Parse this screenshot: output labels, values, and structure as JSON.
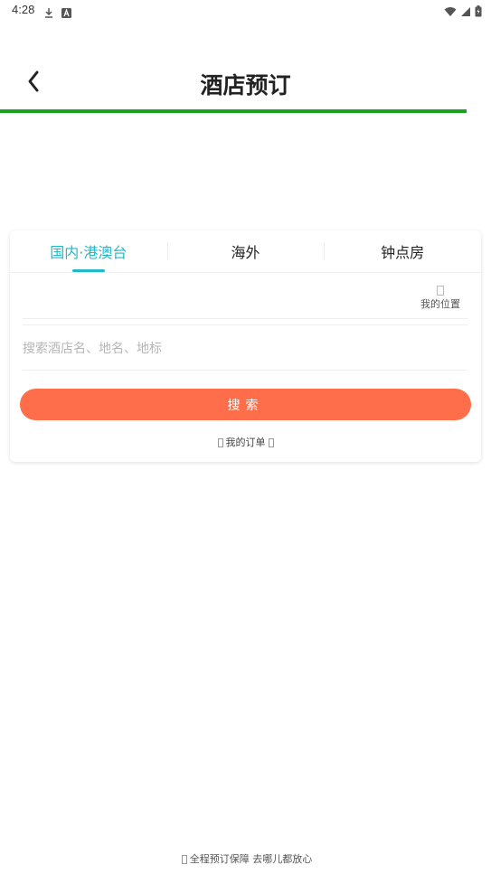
{
  "status_bar": {
    "time": "4:28",
    "icons_left": [
      "download-icon",
      "a-icon"
    ],
    "icons_right": [
      "wifi-icon",
      "signal-icon",
      "battery-icon"
    ]
  },
  "header": {
    "title": "酒店预订",
    "accent_color": "#1aa320"
  },
  "card": {
    "tabs": [
      {
        "label": "国内·港澳台",
        "active": true
      },
      {
        "label": "海外",
        "active": false
      },
      {
        "label": "钟点房",
        "active": false
      }
    ],
    "location_label": "我的位置",
    "search_placeholder": "搜索酒店名、地名、地标",
    "search_button_label": "搜索",
    "orders_label": "我的订单"
  },
  "footer": {
    "text": "全程预订保障 去哪儿都放心"
  },
  "colors": {
    "tab_active": "#21b8c9",
    "search_button": "#ff6e4a"
  }
}
